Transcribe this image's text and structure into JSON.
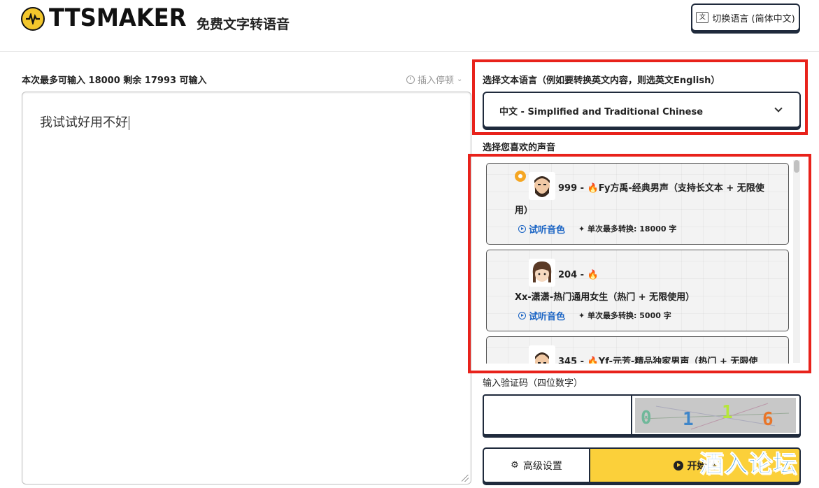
{
  "header": {
    "logo_text": "TTSMAKER",
    "tagline": "免费文字转语音",
    "language_button": "切换语言 (简体中文)"
  },
  "editor": {
    "counter_text": "本次最多可输入 18000 剩余 17993 可输入",
    "insert_pause": "插入停顿",
    "text": "我试试好用不好"
  },
  "language_select": {
    "label": "选择文本语言（例如要转换英文内容，则选英文English）",
    "value": "中文 - Simplified and Traditional Chinese"
  },
  "voices": {
    "label": "选择您喜欢的声音",
    "listen_label": "试听音色",
    "items": [
      {
        "id_prefix": "999 - ",
        "name": "Fy方禹-经典男声（支持长文本 + 无限使用）",
        "max_text": "单次最多转换: 18000 字"
      },
      {
        "id_prefix": "204 - ",
        "name": "Xx-潇潇-热门通用女生（热门 + 无限使用）",
        "max_text": "单次最多转换: 5000 字"
      },
      {
        "id_prefix": "345 - ",
        "name": "Yf-元芳-精品独家男声（热门 + 无限使",
        "max_text": ""
      }
    ]
  },
  "captcha": {
    "label": "输入验证码（四位数字）",
    "value": "",
    "image_chars": [
      "0",
      "1",
      "1",
      "6"
    ]
  },
  "actions": {
    "advanced_settings": "高级设置",
    "start": "开始转"
  },
  "watermark": "酒入论坛",
  "colors": {
    "accent_yellow": "#fbd03a",
    "highlight_red": "#e8221b",
    "link_blue": "#1a64c4",
    "border_dark": "#1f2a3c"
  }
}
